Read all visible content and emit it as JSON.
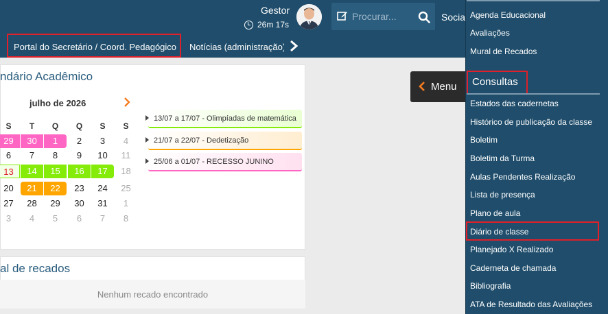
{
  "header": {
    "user_name": "Gestor",
    "session_time": "26m 17s",
    "search_placeholder": "Procurar...",
    "social_label": "Social"
  },
  "subnav": {
    "tabs": [
      {
        "label": "Portal do Secretário / Coord. Pedagógico"
      },
      {
        "label": "Notícias (administração)"
      }
    ]
  },
  "calendar": {
    "title": "ndário Acadêmico",
    "month": "julho de 2026",
    "weekdays": [
      "S",
      "T",
      "Q",
      "Q",
      "S",
      "S"
    ],
    "weeks": [
      [
        "29",
        "30",
        "1",
        "2",
        "3",
        "4"
      ],
      [
        "6",
        "7",
        "8",
        "9",
        "10",
        "11"
      ],
      [
        "13",
        "14",
        "15",
        "16",
        "17",
        "18"
      ],
      [
        "20",
        "21",
        "22",
        "23",
        "24",
        "25"
      ],
      [
        "27",
        "28",
        "29",
        "30",
        "31",
        "1"
      ],
      [
        "3",
        "4",
        "5",
        "6",
        "7",
        "8"
      ]
    ],
    "events": [
      {
        "label": "13/07 a 17/07 - Olimpíadas de matemática",
        "color": "#84ec08"
      },
      {
        "label": "21/07 a 22/07 - Dedetização",
        "color": "#ffa500"
      },
      {
        "label": "25/06 a 01/07 - RECESSO JUNINO",
        "color": "#ff66c4"
      }
    ]
  },
  "recados": {
    "title": "al de recados",
    "empty_text": "Nenhum recado encontrado"
  },
  "menu_button": {
    "label": "Menu"
  },
  "side_panel": {
    "top_items": [
      {
        "label": "Agenda Educacional"
      },
      {
        "label": "Avaliações"
      },
      {
        "label": "Mural de Recados"
      }
    ],
    "section_title": "Consultas",
    "items": [
      {
        "label": "Estados das cadernetas"
      },
      {
        "label": "Histórico de publicação da classe"
      },
      {
        "label": "Boletim"
      },
      {
        "label": "Boletim da Turma"
      },
      {
        "label": "Aulas Pendentes Realização"
      },
      {
        "label": "Lista de presença"
      },
      {
        "label": "Plano de aula"
      },
      {
        "label": "Diário de classe"
      },
      {
        "label": "Planejado X Realizado"
      },
      {
        "label": "Caderneta de chamada"
      },
      {
        "label": "Bibliografia"
      },
      {
        "label": "ATA de Resultado das Avaliações"
      }
    ]
  },
  "colors": {
    "header_bg": "#1f4d6b",
    "highlight_red": "#e0202a",
    "accent_orange": "#f47c20"
  }
}
